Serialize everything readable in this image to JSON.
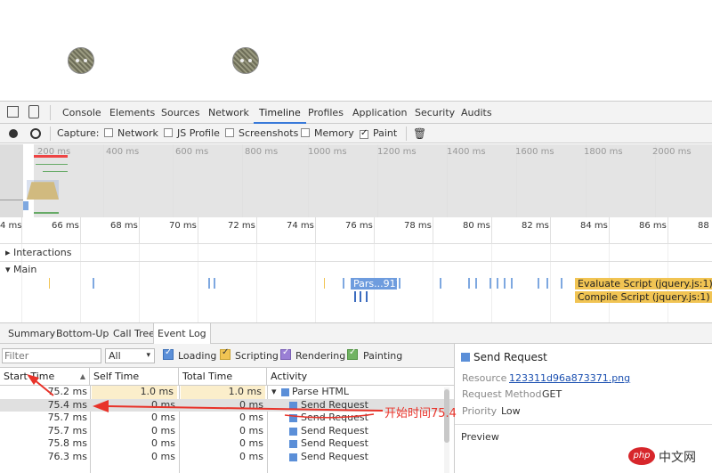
{
  "devtools": {
    "tabs": [
      "Console",
      "Elements",
      "Sources",
      "Network",
      "Timeline",
      "Profiles",
      "Application",
      "Security",
      "Audits"
    ],
    "active_tab": "Timeline"
  },
  "capture": {
    "label": "Capture:",
    "options": [
      {
        "label": "Network",
        "checked": false
      },
      {
        "label": "JS Profile",
        "checked": false
      },
      {
        "label": "Screenshots",
        "checked": false
      },
      {
        "label": "Memory",
        "checked": false
      },
      {
        "label": "Paint",
        "checked": true
      }
    ]
  },
  "overview_ticks": [
    "200 ms",
    "400 ms",
    "600 ms",
    "800 ms",
    "1000 ms",
    "1200 ms",
    "1400 ms",
    "1600 ms",
    "1800 ms",
    "2000 ms"
  ],
  "ruler_ticks": [
    "4 ms",
    "66 ms",
    "68 ms",
    "70 ms",
    "72 ms",
    "74 ms",
    "76 ms",
    "78 ms",
    "80 ms",
    "82 ms",
    "84 ms",
    "86 ms",
    "88"
  ],
  "tracks": {
    "interactions": "Interactions",
    "main": "Main",
    "bars": {
      "parse": "Pars...91])",
      "evaluate": "Evaluate Script (jquery.js:1)",
      "compile": "Compile Script (jquery.js:1)"
    }
  },
  "bottom_tabs": [
    "Summary",
    "Bottom-Up",
    "Call Tree",
    "Event Log"
  ],
  "active_bottom_tab": "Event Log",
  "filter": {
    "placeholder": "Filter",
    "select_value": "All",
    "categories": [
      {
        "label": "Loading",
        "checked": true,
        "color": "#5b8fd8"
      },
      {
        "label": "Scripting",
        "checked": true,
        "color": "#f1c453"
      },
      {
        "label": "Rendering",
        "checked": true,
        "color": "#9a7fd5"
      },
      {
        "label": "Painting",
        "checked": true,
        "color": "#71b363"
      }
    ]
  },
  "table": {
    "headers": [
      "Start Time",
      "Self Time",
      "Total Time",
      "Activity"
    ],
    "rows": [
      {
        "start": "75.2 ms",
        "self": "1.0 ms",
        "total": "1.0 ms",
        "activity": "Parse HTML"
      },
      {
        "start": "75.4 ms",
        "self": "0 ms",
        "total": "0 ms",
        "activity": "Send Request"
      },
      {
        "start": "75.7 ms",
        "self": "0 ms",
        "total": "0 ms",
        "activity": "Send Request"
      },
      {
        "start": "75.7 ms",
        "self": "0 ms",
        "total": "0 ms",
        "activity": "Send Request"
      },
      {
        "start": "75.8 ms",
        "self": "0 ms",
        "total": "0 ms",
        "activity": "Send Request"
      },
      {
        "start": "76.3 ms",
        "self": "0 ms",
        "total": "0 ms",
        "activity": "Send Request"
      }
    ]
  },
  "details": {
    "title": "Send Request",
    "resource_label": "Resource",
    "resource_value": "123311d96a873371.png",
    "method_label": "Request Method",
    "method_value": "GET",
    "priority_label": "Priority",
    "priority_value": "Low",
    "preview_label": "Preview"
  },
  "annotation": {
    "text": "开始时间75.4",
    "color": "#e8332a"
  },
  "watermark": "php 中文网"
}
